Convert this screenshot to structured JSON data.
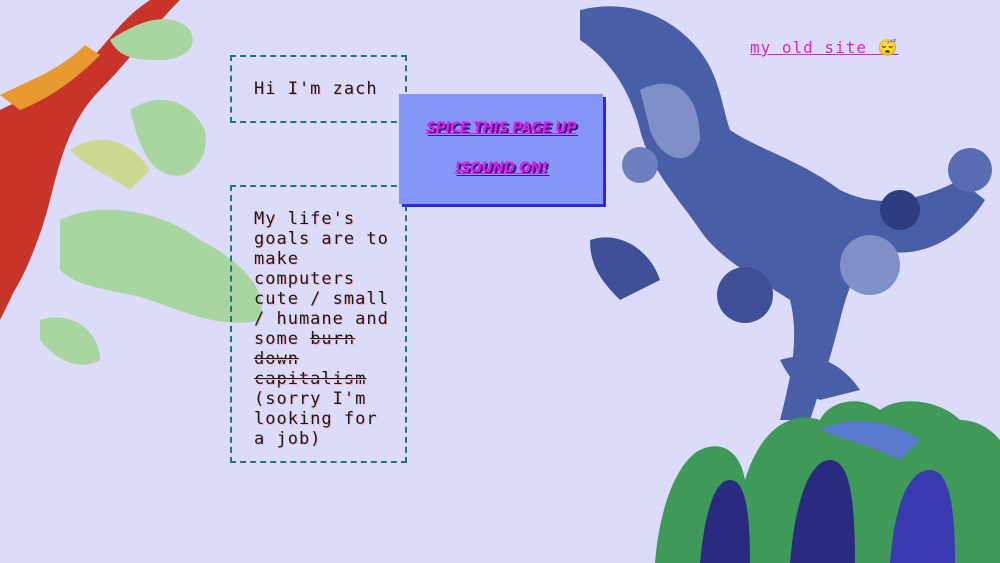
{
  "intro": {
    "greeting": "Hi I'm zach"
  },
  "goals": {
    "text_before": "My life's goals are to make computers cute / small / humane and some ",
    "strikethrough": "burn down capitalism",
    "text_after": " (sorry I'm looking for a job)"
  },
  "spice_box": {
    "line1": "SPICE THIS PAGE UP",
    "line2": "!SOUND ON!"
  },
  "nav": {
    "old_site": "my old site 😴"
  },
  "colors": {
    "background": "#dcdcfa",
    "border": "#1f7a6e",
    "link": "#e020c8",
    "spice_bg": "#8696f8"
  }
}
